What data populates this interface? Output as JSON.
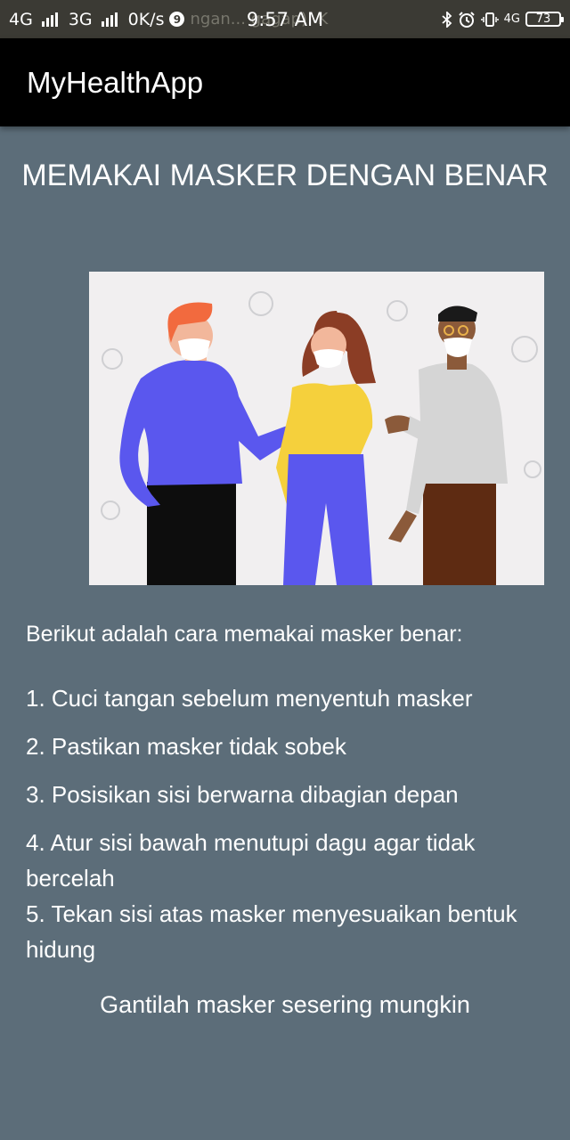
{
  "status_bar": {
    "network1": "4G",
    "network2": "3G",
    "speed": "0K/s",
    "notif_count": "9",
    "bg_text": "ngan... gagap). K",
    "time": "9:57 AM",
    "network3": "4G",
    "battery": "73"
  },
  "app_bar": {
    "title": "MyHealthApp"
  },
  "content": {
    "heading": "MEMAKAI MASKER DENGAN BENAR",
    "intro": "Berikut adalah cara memakai masker benar:",
    "steps": [
      "1. Cuci tangan sebelum menyentuh masker",
      "2. Pastikan masker tidak sobek",
      "3. Posisikan sisi berwarna dibagian depan",
      "4. Atur sisi bawah menutupi dagu agar tidak bercelah",
      "5. Tekan sisi atas masker menyesuaikan bentuk hidung"
    ],
    "footer": "Gantilah masker sesering mungkin"
  },
  "colors": {
    "background": "#5c6d79",
    "app_bar": "#000000",
    "status_bar": "#3b3a34",
    "text": "#ffffff"
  },
  "icons": [
    "signal-icon",
    "notification-badge-icon",
    "bluetooth-icon",
    "alarm-icon",
    "vibrate-icon",
    "battery-icon"
  ]
}
